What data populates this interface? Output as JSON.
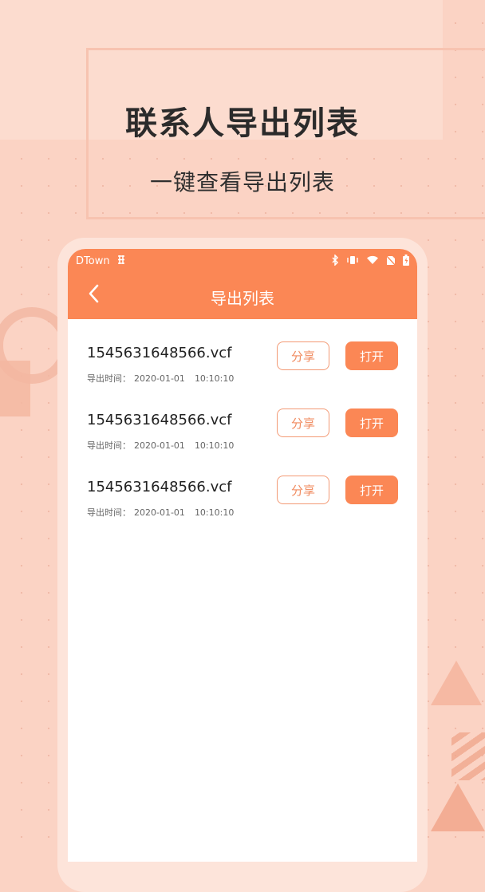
{
  "hero": {
    "title": "联系人导出列表",
    "subtitle": "一键查看导出列表"
  },
  "status_bar": {
    "carrier": "DTown",
    "icons": [
      "signal-grid-icon",
      "bluetooth-icon",
      "vibrate-icon",
      "wifi-icon",
      "no-sim-icon",
      "battery-icon"
    ]
  },
  "app_bar": {
    "title": "导出列表",
    "back_icon": "chevron-left-icon"
  },
  "list": {
    "items": [
      {
        "file_name": "1545631648566.vcf",
        "time_label": "导出时间：",
        "date": "2020-01-01",
        "time": "10:10:10",
        "share_label": "分享",
        "open_label": "打开"
      },
      {
        "file_name": "1545631648566.vcf",
        "time_label": "导出时间：",
        "date": "2020-01-01",
        "time": "10:10:10",
        "share_label": "分享",
        "open_label": "打开"
      },
      {
        "file_name": "1545631648566.vcf",
        "time_label": "导出时间：",
        "date": "2020-01-01",
        "time": "10:10:10",
        "share_label": "分享",
        "open_label": "打开"
      }
    ]
  },
  "colors": {
    "accent": "#fb8755",
    "background": "#fbd3c4"
  }
}
